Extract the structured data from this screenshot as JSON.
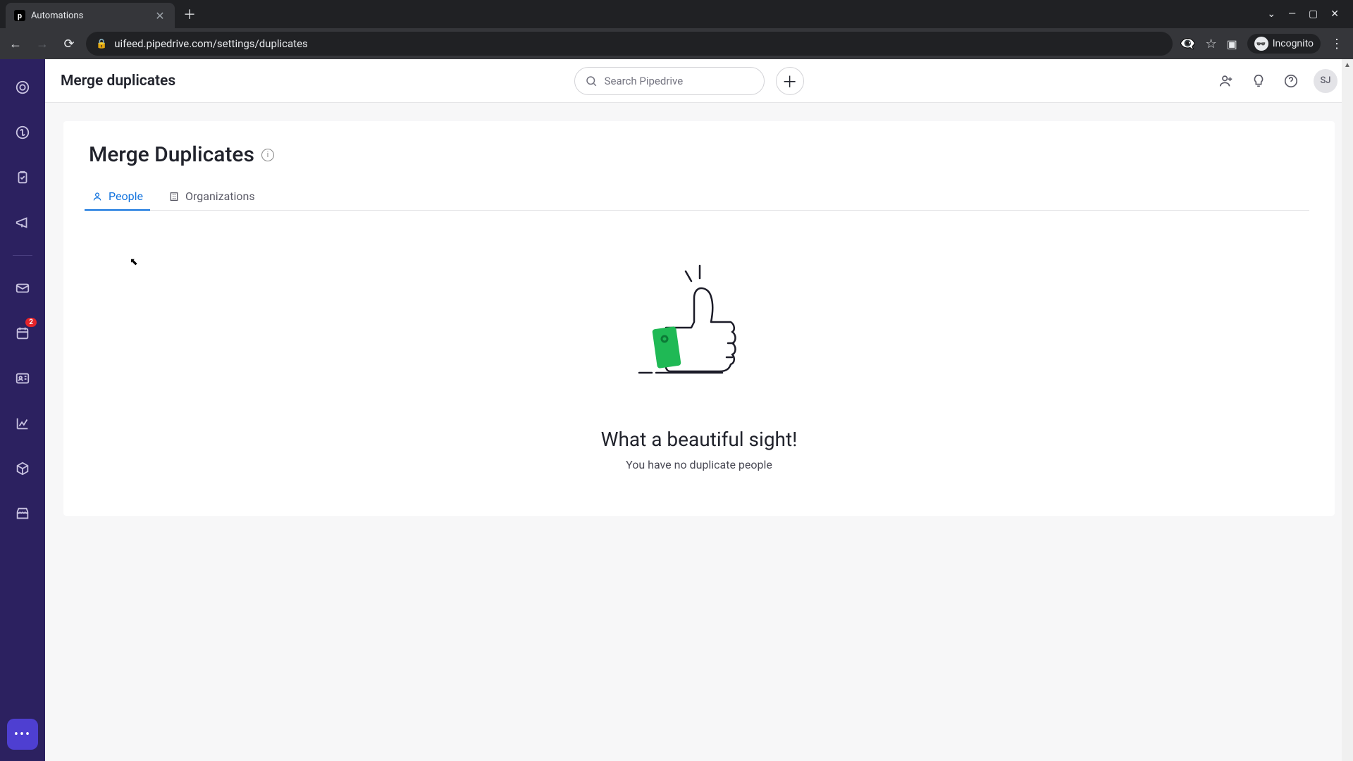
{
  "browser": {
    "tab_title": "Automations",
    "tab_favicon_letter": "p",
    "url": "uifeed.pipedrive.com/settings/duplicates",
    "incognito_label": "Incognito"
  },
  "header": {
    "title": "Merge duplicates",
    "search_placeholder": "Search Pipedrive",
    "avatar_initials": "SJ"
  },
  "sidebar": {
    "badge_count": "2"
  },
  "page": {
    "title": "Merge Duplicates",
    "tabs": {
      "people": "People",
      "organizations": "Organizations"
    },
    "empty": {
      "title": "What a beautiful sight!",
      "subtitle": "You have no duplicate people"
    }
  }
}
